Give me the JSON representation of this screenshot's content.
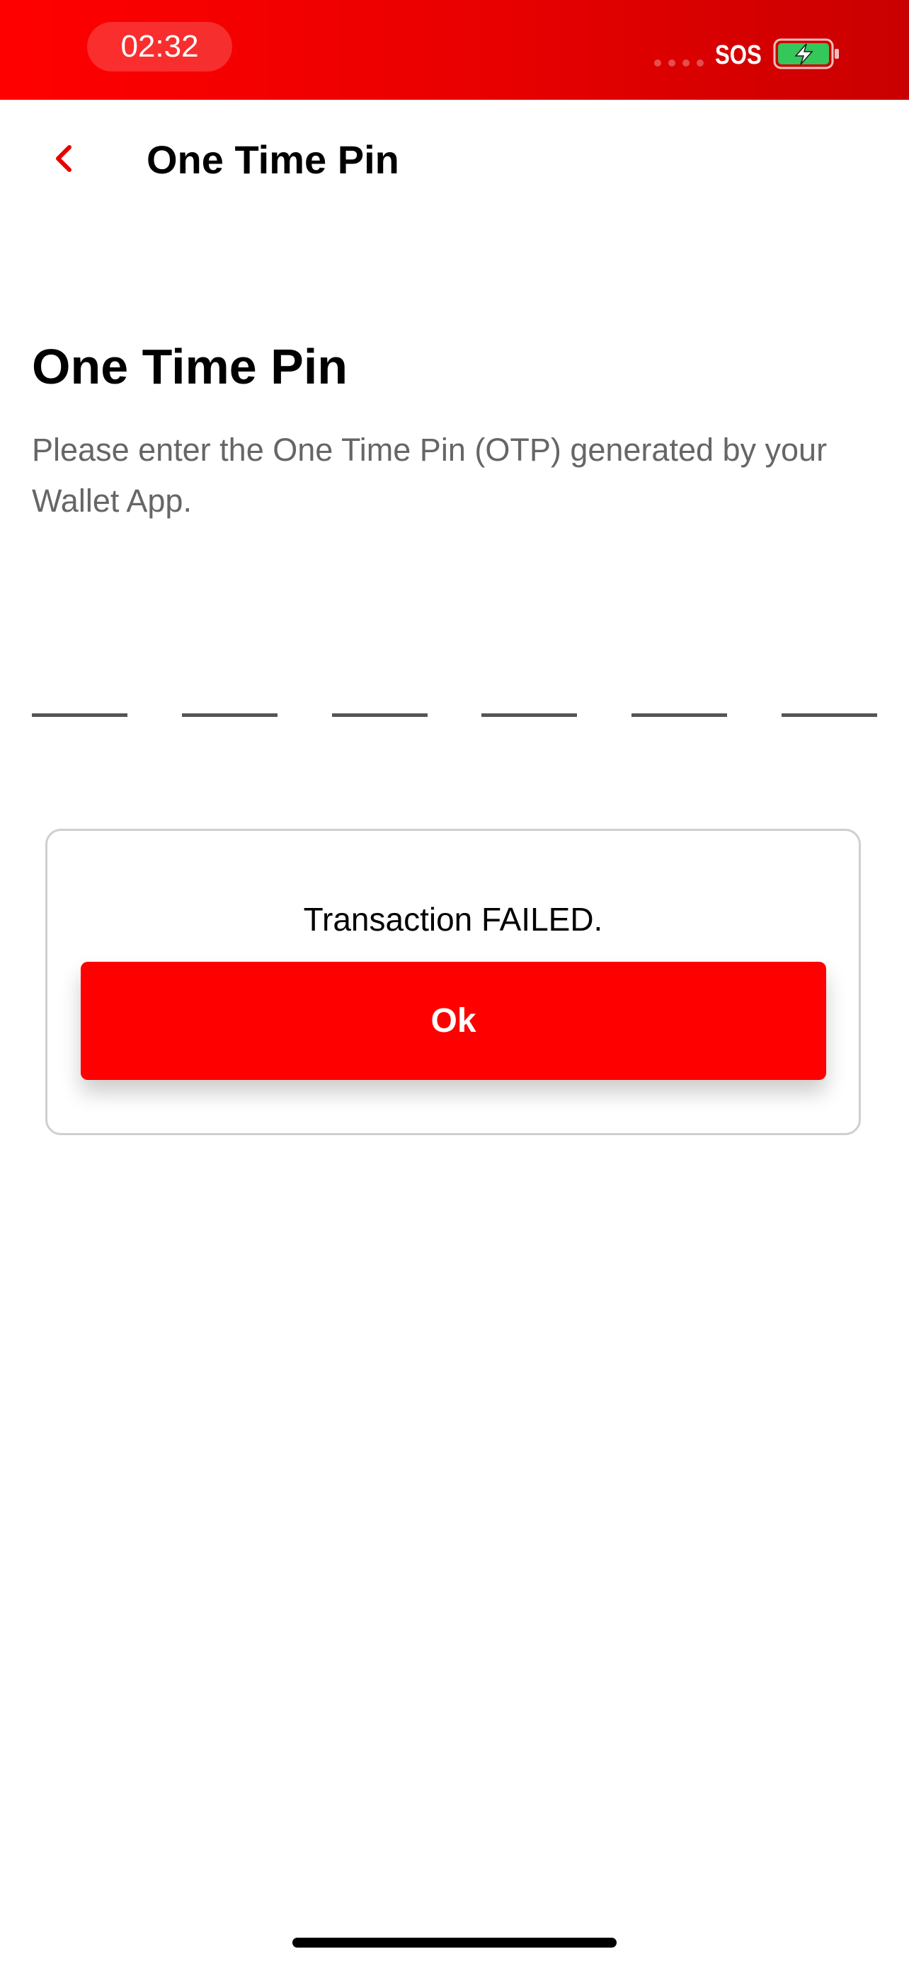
{
  "status_bar": {
    "time": "02:32",
    "carrier_text": "SOS",
    "icons": [
      "signal-dots-icon",
      "battery-charging-icon"
    ]
  },
  "nav": {
    "back_icon": "chevron-left-icon",
    "title": "One Time Pin"
  },
  "main": {
    "title": "One Time Pin",
    "description": "Please enter the One Time Pin (OTP) generated by your Wallet App.",
    "otp_digits": [
      "",
      "",
      "",
      "",
      "",
      ""
    ]
  },
  "dialog": {
    "message": "Transaction FAILED.",
    "ok_label": "Ok"
  },
  "colors": {
    "brand_red": "#ff0000",
    "status_bar_dark_red": "#c90000",
    "battery_green": "#34c759",
    "muted_text": "#666666"
  }
}
